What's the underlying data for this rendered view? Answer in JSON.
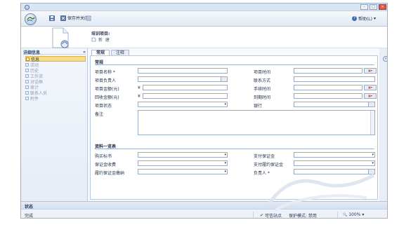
{
  "window": {
    "min_glyph": "–",
    "max_glyph": "□",
    "close_glyph": "×"
  },
  "toolbar": {
    "save_close_label": "保存并关闭",
    "help_label": "帮助(L)",
    "help_glyph": "?",
    "help_arrow": "▾"
  },
  "header": {
    "entity_type": "培训项目:",
    "entity_name": "新 建"
  },
  "leftnav": {
    "title": "详细信息",
    "collapse_glyph": "«",
    "items": [
      {
        "label": "信息",
        "active": true
      },
      {
        "label": "活动",
        "active": false
      },
      {
        "label": "历史",
        "active": false
      },
      {
        "label": "工作流",
        "active": false
      },
      {
        "label": "对话框",
        "active": false
      },
      {
        "label": "审计",
        "active": false
      },
      {
        "label": "联系人员",
        "active": false
      },
      {
        "label": "附件",
        "active": false
      }
    ]
  },
  "tabs": [
    {
      "label": "常规",
      "active": true
    },
    {
      "label": "注释",
      "active": false
    }
  ],
  "form": {
    "section1_title": "常规",
    "project_name_label": "项目名称 *",
    "project_owner_label": "项目负责人",
    "project_amount_label": "项目金额(元)",
    "received_amount_label": "回收金额(元)",
    "project_status_label": "项目状态",
    "remark_label": "备注",
    "project_time_label": "项目时间",
    "contact_method_label": "联系方式",
    "handling_time_label": "手续时间",
    "arrival_time_label": "到期时间",
    "bank_label": "银行",
    "currency_symbol": "¥",
    "dropdown_glyph": "▾",
    "date_glyph": "▦▾",
    "section2_title": "资料一览表",
    "bid_doc_label": "购买标书",
    "guarantee_fee_label": "保证金收费",
    "performance_bond_label": "履约保证金缴纳",
    "pay_guarantee_label": "支付保证金",
    "pay_performance_label": "支付履约保证金",
    "person_in_charge_label": "负责人 *"
  },
  "side_collapse_glyph": "«",
  "footer": {
    "label": "状态"
  },
  "status": {
    "left_text": "完成",
    "trusted_site": "可信站点",
    "protected_mode": "保护模式: 禁用",
    "zoom": "100%",
    "zoom_glyph": "🔍",
    "check_glyph": "✔"
  },
  "colors": {
    "active_nav": "#f5dd8a",
    "window_bg": "#e8eef7",
    "border": "#9fb2cc"
  }
}
